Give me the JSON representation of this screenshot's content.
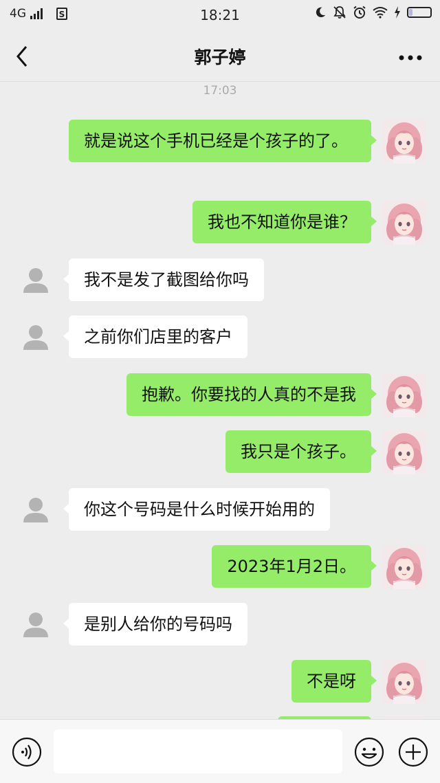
{
  "status_bar": {
    "network": "4G",
    "sim_label": "S",
    "time": "18:21",
    "battery_level": 0.15,
    "icons": [
      "moon-icon",
      "mute-bell-icon",
      "alarm-icon",
      "wifi-icon",
      "charging-icon",
      "battery-icon"
    ]
  },
  "header": {
    "title": "郭子婷",
    "back_icon": "chevron-left-icon",
    "more_icon": "more-dots-icon"
  },
  "chat": {
    "timestamp": "17:03",
    "messages": [
      {
        "sender": "self",
        "text": "就是说这个手机已经是个孩子的了。"
      },
      {
        "sender": "self",
        "text": "我也不知道你是谁？"
      },
      {
        "sender": "other",
        "text": "我不是发了截图给你吗"
      },
      {
        "sender": "other",
        "text": "之前你们店里的客户"
      },
      {
        "sender": "self",
        "text": "抱歉。你要找的人真的不是我"
      },
      {
        "sender": "self",
        "text": "我只是个孩子。"
      },
      {
        "sender": "other",
        "text": "你这个号码是什么时候开始用的"
      },
      {
        "sender": "self",
        "text": "2023年1月2日。"
      },
      {
        "sender": "other",
        "text": "是别人给你的号码吗"
      },
      {
        "sender": "self",
        "text": "不是呀"
      },
      {
        "sender": "self",
        "text": ""
      }
    ]
  },
  "input_bar": {
    "text_value": "",
    "voice_icon": "voice-icon",
    "emoji_icon": "emoji-icon",
    "add_icon": "plus-icon"
  },
  "colors": {
    "self_bubble": "#95ec69",
    "other_bubble": "#ffffff",
    "background": "#ededed"
  }
}
